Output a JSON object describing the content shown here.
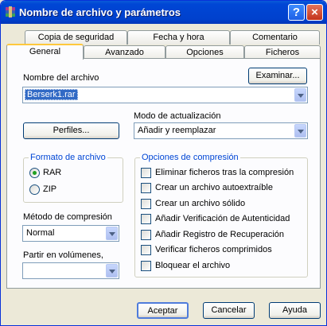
{
  "window": {
    "title": "Nombre de archivo y parámetros",
    "help_label": "?",
    "close_label": "×"
  },
  "tabs_back": [
    "Copia de seguridad",
    "Fecha y hora",
    "Comentario"
  ],
  "tabs_front": [
    "General",
    "Avanzado",
    "Opciones",
    "Ficheros"
  ],
  "active_tab": "General",
  "archive": {
    "label": "Nombre del archivo",
    "browse_label": "Examinar...",
    "value": "Berserk1.rar"
  },
  "profiles_label": "Perfiles...",
  "update_mode": {
    "label": "Modo de actualización",
    "value": "Añadir y reemplazar"
  },
  "format": {
    "title": "Formato de archivo",
    "options": [
      "RAR",
      "ZIP"
    ],
    "selected": "RAR"
  },
  "compression_method": {
    "label": "Método de compresión",
    "value": "Normal"
  },
  "split": {
    "label": "Partir en volúmenes,",
    "value": ""
  },
  "compression_options": {
    "title": "Opciones de compresión",
    "items": [
      {
        "label": "Eliminar ficheros tras la compresión",
        "checked": false
      },
      {
        "label": "Crear un archivo autoextraíble",
        "checked": false
      },
      {
        "label": "Crear un archivo sólido",
        "checked": false
      },
      {
        "label": "Añadir Verificación de Autenticidad",
        "checked": false
      },
      {
        "label": "Añadir Registro de Recuperación",
        "checked": false
      },
      {
        "label": "Verificar ficheros comprimidos",
        "checked": false
      },
      {
        "label": "Bloquear el archivo",
        "checked": false
      }
    ]
  },
  "footer": {
    "ok": "Aceptar",
    "cancel": "Cancelar",
    "help": "Ayuda"
  },
  "colors": {
    "titlebar": "#0046d5",
    "group_title": "#0046d5",
    "selection": "#316ac5",
    "radio_dot": "#21a121",
    "active_tab_accent": "#ffc83c"
  }
}
